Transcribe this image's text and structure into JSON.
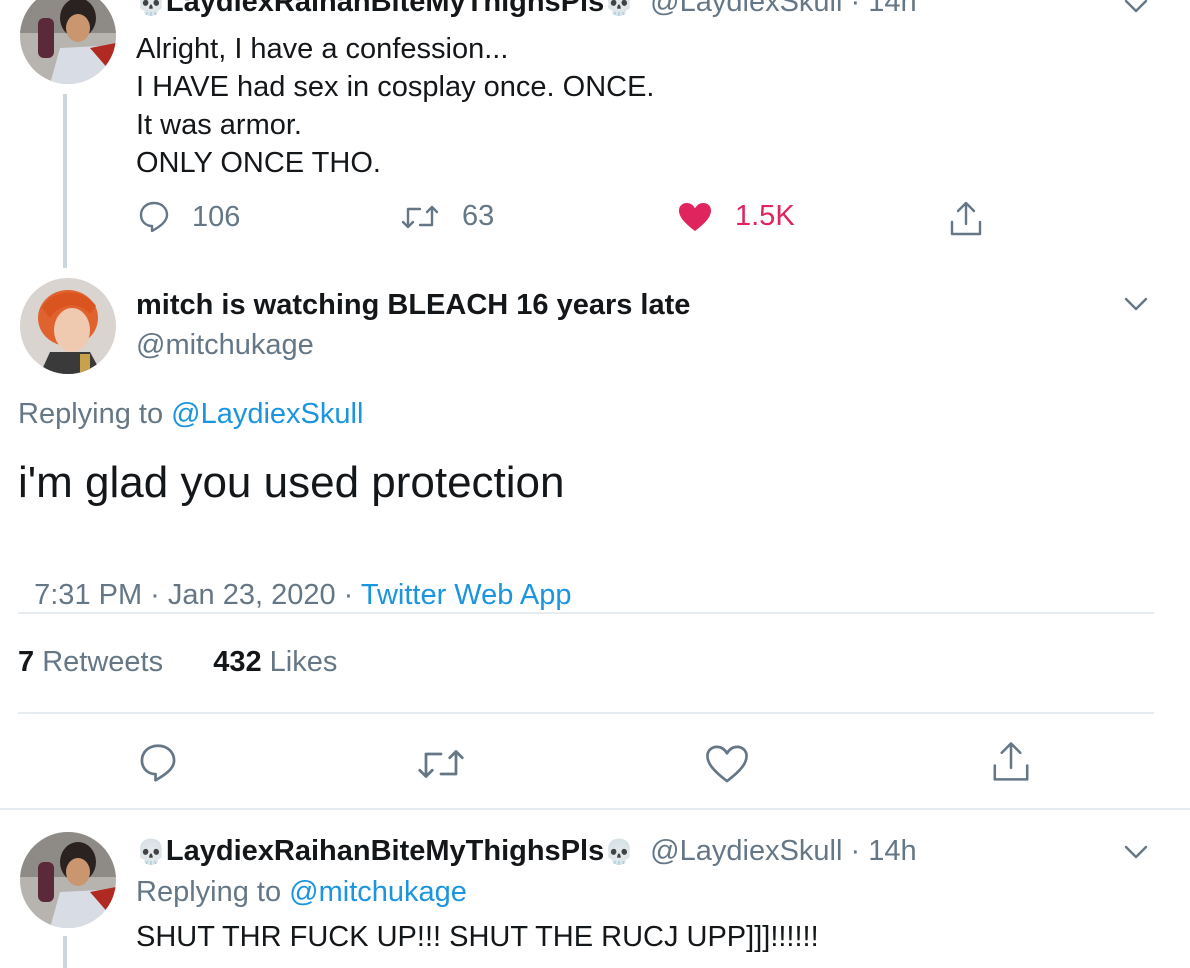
{
  "parent_tweet": {
    "display_name": "LaydiexRaihanBiteMyThighsPls",
    "handle": "@LaydiexSkull",
    "time": "14h",
    "text_lines": [
      "Alright, I have a confession...",
      "I HAVE had sex in cosplay once. ONCE.",
      "It was armor.",
      "ONLY ONCE THO."
    ],
    "replies": "106",
    "retweets": "63",
    "likes": "1.5K"
  },
  "main_tweet": {
    "display_name": "mitch is watching BLEACH 16 years late",
    "handle": "@mitchukage",
    "replying_prefix": "Replying to",
    "replying_to": "@LaydiexSkull",
    "text": "i'm glad you used protection",
    "timestamp": "7:31 PM · Jan 23, 2020 · ",
    "source": "Twitter Web App",
    "retweet_count": "7",
    "retweet_label": "Retweets",
    "like_count": "432",
    "like_label": "Likes"
  },
  "reply_tweet": {
    "display_name": "LaydiexRaihanBiteMyThighsPls",
    "handle": "@LaydiexSkull",
    "time": "14h",
    "replying_prefix": "Replying to",
    "replying_to": "@mitchukage",
    "text": "SHUT THR FUCK UP!!! SHUT THE RUCJ UPP]]]!!!!!!"
  },
  "colors": {
    "text": "#14171a",
    "secondary": "#657786",
    "link": "#1b95e0",
    "like": "#e0245e",
    "divider": "#e6ecf0"
  }
}
